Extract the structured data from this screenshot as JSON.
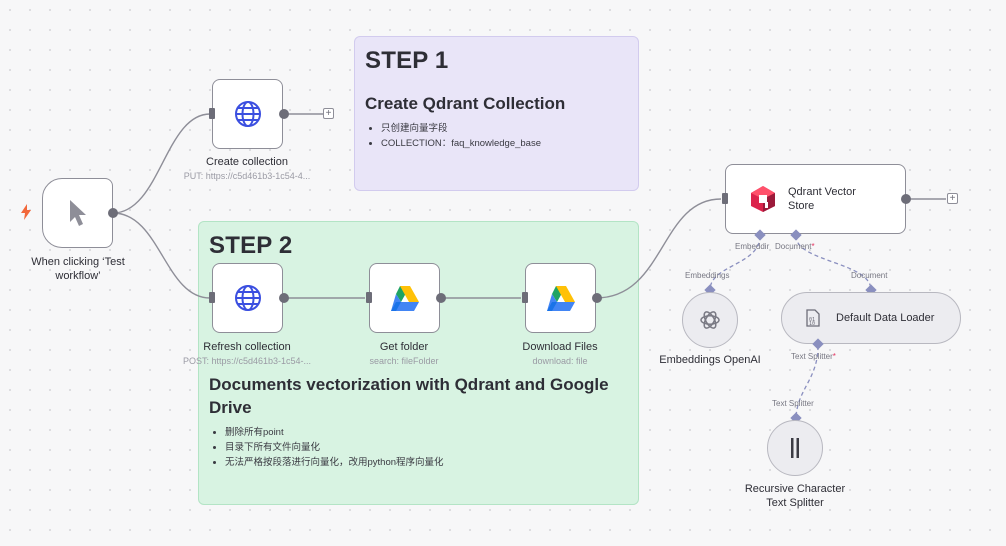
{
  "step1": {
    "heading": "STEP 1",
    "title": "Create Qdrant Collection",
    "bullets": [
      "只创建向量字段",
      "COLLECTION：faq_knowledge_base"
    ]
  },
  "step2": {
    "heading": "STEP 2",
    "title": "Documents vectorization with Qdrant and Google Drive",
    "bullets": [
      "删除所有point",
      "目录下所有文件向量化",
      "无法严格按段落进行向量化，改用python程序向量化"
    ]
  },
  "nodes": {
    "trigger": {
      "label": "When clicking ‘Test workflow’",
      "icon": "cursor-icon"
    },
    "create_collection": {
      "label": "Create collection",
      "sub": "PUT: https://c5d461b3-1c54-4...",
      "icon": "globe-icon"
    },
    "refresh_collection": {
      "label": "Refresh collection",
      "sub": "POST: https://c5d461b3-1c54-...",
      "icon": "globe-icon"
    },
    "get_folder": {
      "label": "Get folder",
      "sub": "search: fileFolder",
      "icon": "google-drive-icon"
    },
    "download_files": {
      "label": "Download Files",
      "sub": "download: file",
      "icon": "google-drive-icon"
    },
    "qdrant": {
      "label": "Qdrant Vector Store",
      "icon": "qdrant-icon"
    },
    "embeddings": {
      "label": "Embeddings OpenAI",
      "icon": "openai-icon"
    },
    "loader": {
      "label": "Default Data Loader",
      "icon": "document-icon"
    },
    "splitter": {
      "label": "Recursive Character Text Splitter",
      "icon": "splitter-icon"
    }
  },
  "ports": {
    "qdrant_embedding": "Embeddir",
    "qdrant_document": "Document",
    "embeddings_out": "Embeddings",
    "loader_in": "Document",
    "loader_splitter": "Text Splitter",
    "splitter_out": "Text Splitter",
    "required_mark": "*"
  },
  "colors": {
    "step1_bg": "#e9e5f8",
    "step2_bg": "#d8f3e2",
    "globe": "#3b4fe0",
    "trigger_bolt": "#f2673a",
    "connector": "#8a8fbf"
  }
}
